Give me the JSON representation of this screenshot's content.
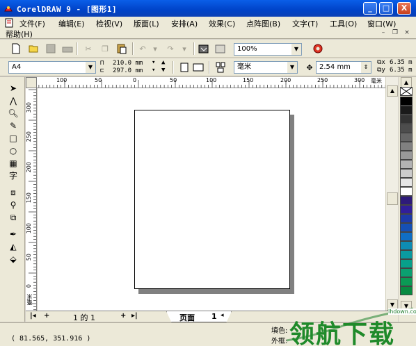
{
  "window": {
    "title": "CorelDRAW 9 - [图形1]",
    "minimize": "_",
    "maximize": "□",
    "close": "X"
  },
  "menu": {
    "items": [
      "文件(F)",
      "编辑(E)",
      "检视(V)",
      "版面(L)",
      "安排(A)",
      "效果(C)",
      "点阵图(B)",
      "文字(T)",
      "工具(O)",
      "窗口(W)"
    ],
    "help": "帮助(H)"
  },
  "toolbar": {
    "zoom": "100%"
  },
  "property_bar": {
    "page_size": "A4",
    "width": "210.0 mm",
    "height": "297.0 mm",
    "units": "毫米",
    "nudge": "2.54 mm",
    "dup_x": "6.35 m",
    "dup_y": "6.35 m"
  },
  "ruler": {
    "h_ticks": [
      "100",
      "50",
      "0",
      "50",
      "100",
      "150",
      "200",
      "250",
      "300"
    ],
    "h_unit": "毫米",
    "v_ticks": [
      "300",
      "250",
      "200",
      "150",
      "100",
      "50",
      "0"
    ],
    "v_unit": "毫米"
  },
  "page_nav": {
    "indicator": "1 的 1",
    "tab_label": "页面",
    "tab_number": "1"
  },
  "status": {
    "coords": "( 81.565, 351.916 )",
    "fill_label": "填色:",
    "outline_label": "外框:"
  },
  "palette": {
    "colors": [
      "#000000",
      "#1a1a1a",
      "#333333",
      "#4d4d4d",
      "#666666",
      "#808080",
      "#999999",
      "#b3b3b3",
      "#cccccc",
      "#e6e6e6",
      "#ffffff",
      "#2e1a7a",
      "#311e9a",
      "#1e3aa8",
      "#1650b4",
      "#0f6ec4",
      "#0e8cb4",
      "#0a9aa0",
      "#08a08a",
      "#0aa070",
      "#0a9a55",
      "#088a40"
    ]
  },
  "watermark": {
    "brand": "领航下载",
    "url": "lhdown.com"
  }
}
